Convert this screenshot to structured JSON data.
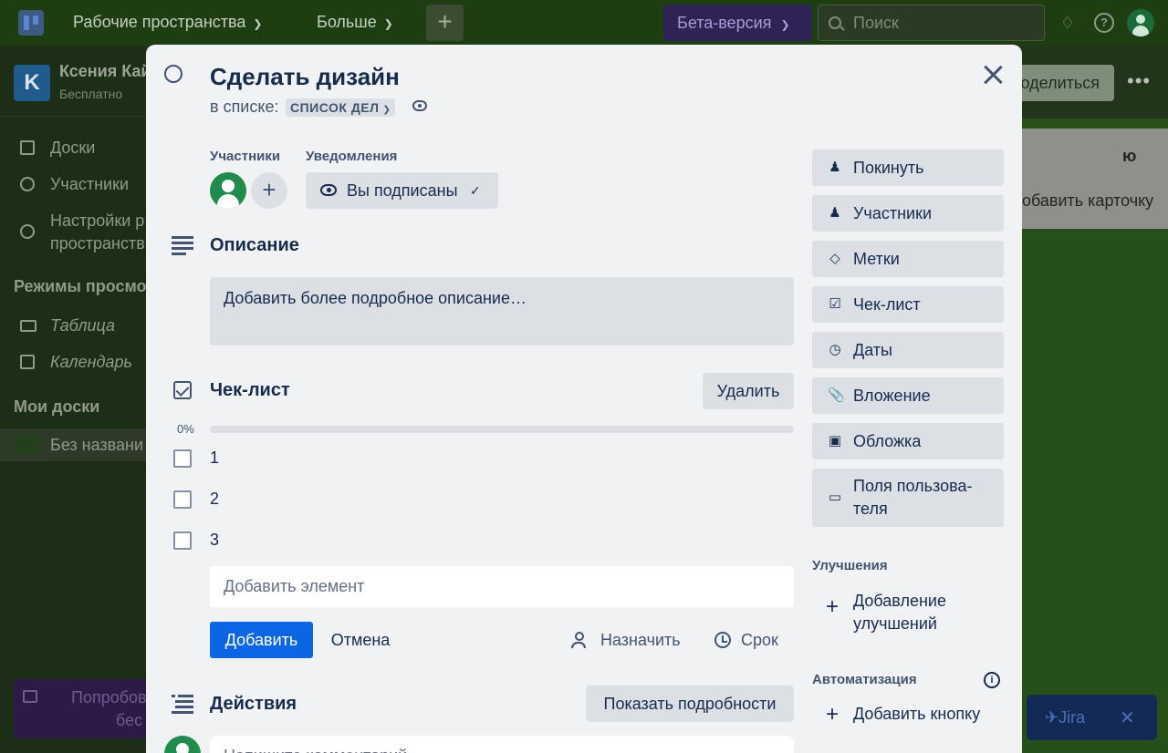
{
  "header": {
    "workspaces_label": "Рабочие пространства",
    "more_label": "Больше",
    "beta_label": "Бета-версия",
    "search_placeholder": "Поиск"
  },
  "sidebar": {
    "workspace_initial": "K",
    "workspace_name": "Ксения Кай",
    "workspace_plan": "Бесплатно",
    "items": [
      {
        "label": "Доски",
        "icon": "board-icon"
      },
      {
        "label": "Участники",
        "icon": "person-icon"
      },
      {
        "label": "Настройки р",
        "label2": "пространств",
        "icon": "gear-icon"
      }
    ],
    "views_heading": "Режимы просмо",
    "views": [
      {
        "label": "Таблица",
        "icon": "table-icon"
      },
      {
        "label": "Календарь",
        "icon": "calendar-icon"
      }
    ],
    "my_boards_heading": "Мои доски",
    "boards": [
      {
        "label": "Без названи"
      }
    ],
    "promo_line1": "Попробов",
    "promo_line2": "бес"
  },
  "board": {
    "share_label": "оделиться",
    "list_title_fragment": "ю",
    "add_card_fragment": "обавить карточку",
    "jira_label": "Jira"
  },
  "card": {
    "title": "Сделать дизайн",
    "in_list_label": "в списке:",
    "list_name": "СПИСОК ДЕЛ",
    "members_label": "Участники",
    "notifications_label": "Уведомления",
    "watching_label": "Вы подписаны",
    "description_title": "Описание",
    "description_placeholder": "Добавить более подробное описание…",
    "checklist": {
      "title": "Чек-лист",
      "delete_label": "Удалить",
      "progress_text": "0%",
      "progress": 0,
      "items": [
        {
          "text": "1",
          "checked": false
        },
        {
          "text": "2",
          "checked": false
        },
        {
          "text": "3",
          "checked": false
        }
      ],
      "add_item_placeholder": "Добавить элемент",
      "add_label": "Добавить",
      "cancel_label": "Отмена",
      "assign_label": "Назначить",
      "due_label": "Срок"
    },
    "activity_title": "Действия",
    "show_details_label": "Показать подробности",
    "comment_placeholder": "Напишите комментарий…"
  },
  "actions": {
    "buttons": [
      {
        "label": "Покинуть",
        "icon": "person-minus-icon"
      },
      {
        "label": "Участники",
        "icon": "person-icon"
      },
      {
        "label": "Метки",
        "icon": "tag-icon"
      },
      {
        "label": "Чек-лист",
        "icon": "checkbox-icon"
      },
      {
        "label": "Даты",
        "icon": "clock-icon"
      },
      {
        "label": "Вложение",
        "icon": "paperclip-icon"
      },
      {
        "label": "Обложка",
        "icon": "cover-icon"
      },
      {
        "label": "Поля пользова-",
        "label2": "теля",
        "icon": "field-icon"
      }
    ],
    "powerups_heading": "Улучшения",
    "add_powerups_line1": "Добавление",
    "add_powerups_line2": "улучшений",
    "automation_heading": "Автоматизация",
    "add_button_label": "Добавить кнопку"
  },
  "colors": {
    "primary": "#0c66e4",
    "modal_bg": "#f1f2f4",
    "button_bg": "#dcdfe4",
    "avatar": "#1f8b4c"
  }
}
